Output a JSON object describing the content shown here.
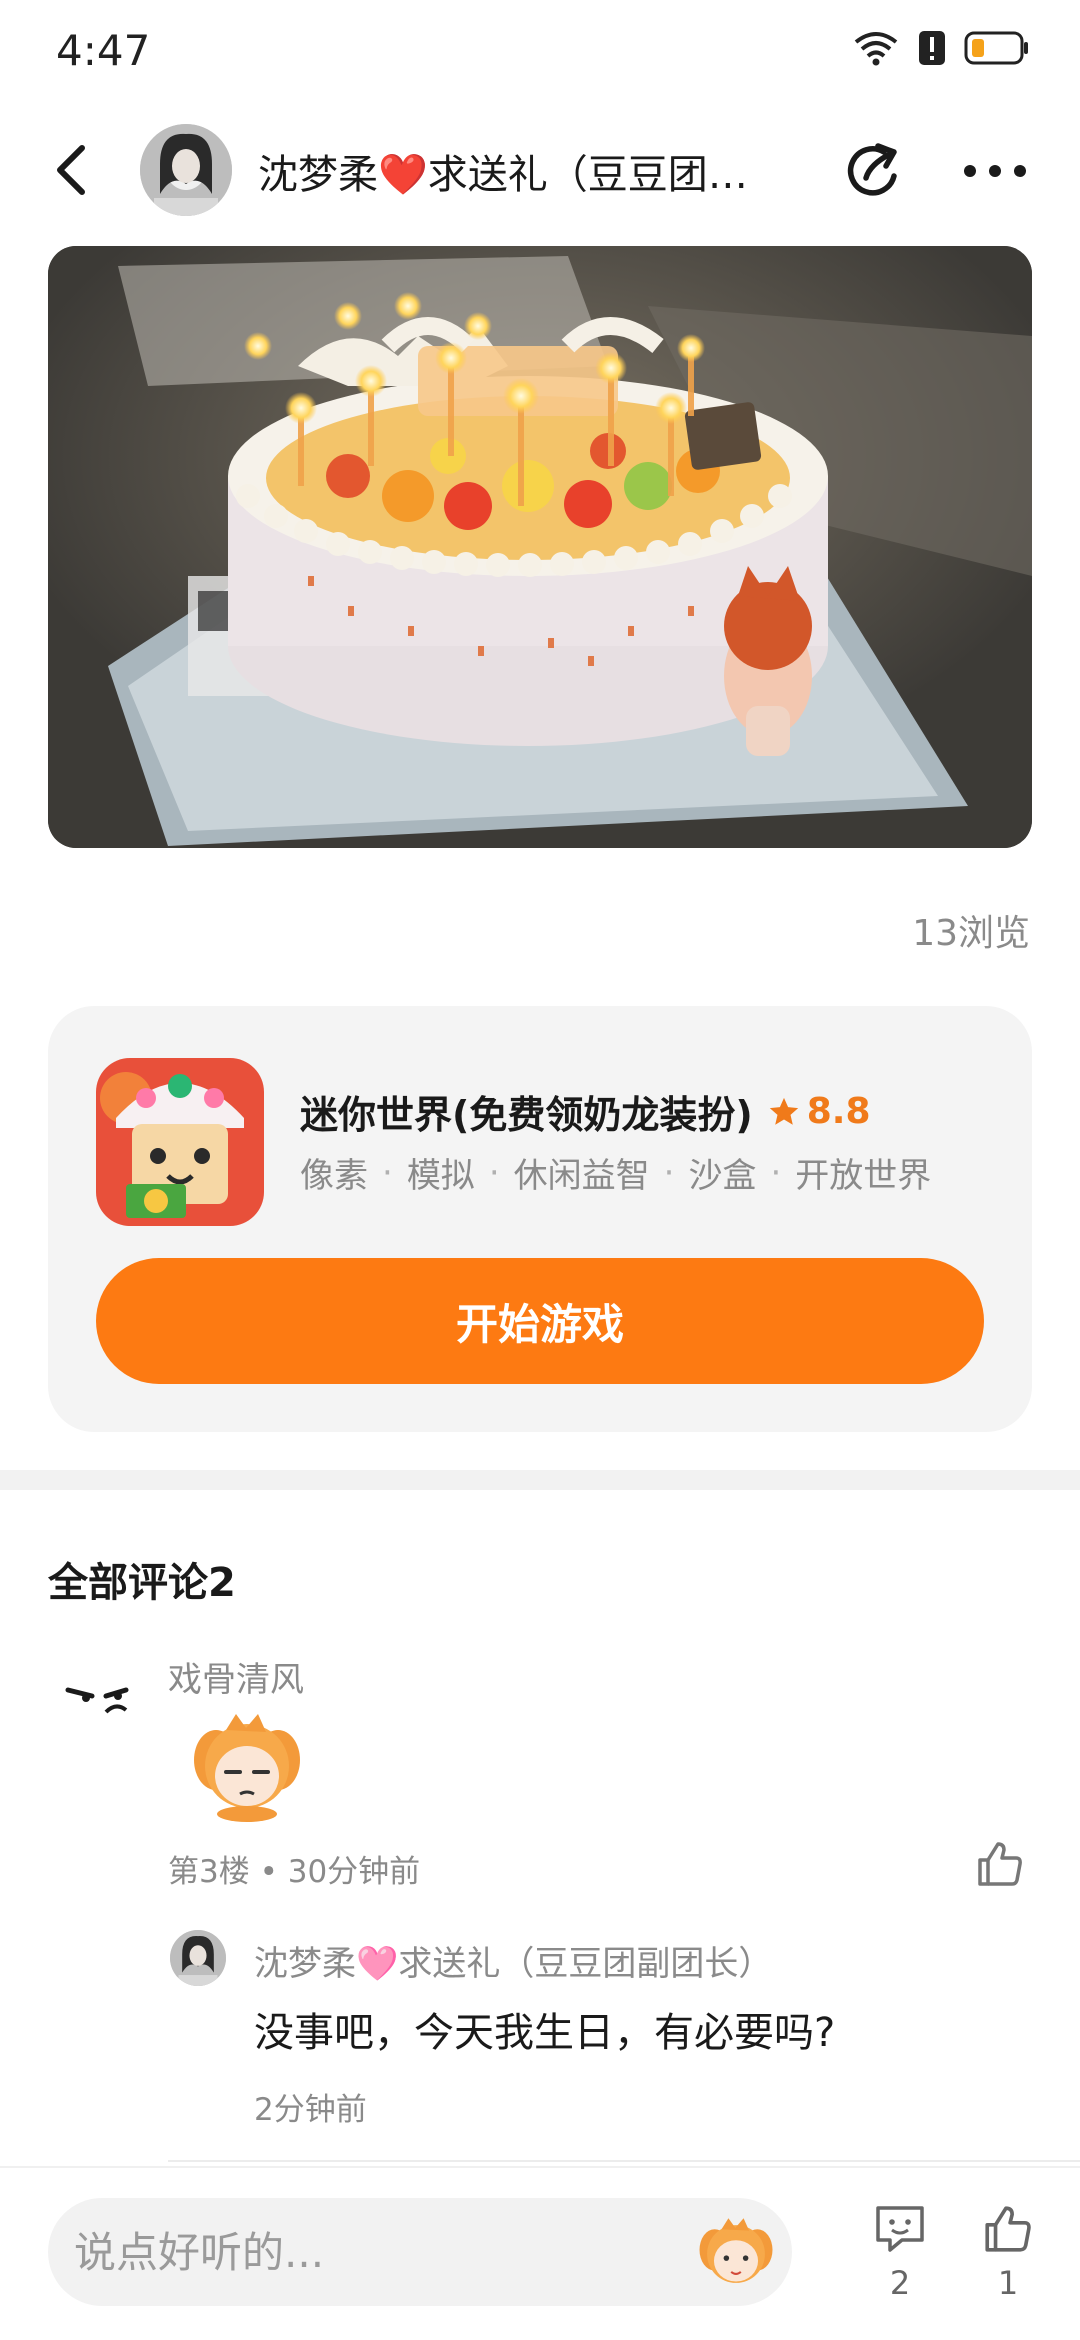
{
  "status_bar": {
    "time": "4:47"
  },
  "header": {
    "title": "沈梦柔❤️求送礼（豆豆团副团长）"
  },
  "post": {
    "views": "13浏览"
  },
  "game": {
    "name": "迷你世界(免费领奶龙装扮)",
    "rating": "8.8",
    "tags": [
      "像素",
      "模拟",
      "休闲益智",
      "沙盒",
      "开放世界"
    ],
    "start_label": "开始游戏"
  },
  "comments": {
    "heading": "全部评论2",
    "items": [
      {
        "author": "戏骨清风",
        "meta": "第3楼 • 30分钟前",
        "reply": {
          "author": "沈梦柔🩷求送礼（豆豆团副团长）",
          "text": "没事吧，今天我生日，有必要吗?",
          "time": "2分钟前"
        }
      }
    ]
  },
  "bottom_bar": {
    "input_placeholder": "说点好听的...",
    "comment_count": "2",
    "like_count": "1"
  },
  "colors": {
    "accent": "#fd7a12",
    "rating": "#f07a1a"
  }
}
